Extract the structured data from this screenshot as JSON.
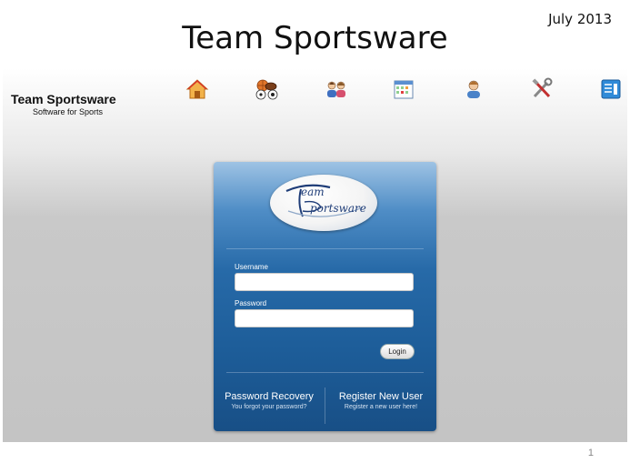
{
  "slide": {
    "title": "Team Sportsware",
    "date": "July 2013",
    "page_number": "1"
  },
  "app": {
    "brand_name": "Team Sportsware",
    "brand_tagline": "Software for Sports",
    "nav_icons": [
      "home-icon",
      "sports-balls-icon",
      "team-members-icon",
      "calendar-icon",
      "user-profile-icon",
      "tools-icon",
      "reports-icon"
    ]
  },
  "login": {
    "logo_line1": "eam",
    "logo_line2": "portsware",
    "username_label": "Username",
    "username_value": "",
    "password_label": "Password",
    "password_value": "",
    "login_button": "Login",
    "recovery_title": "Password Recovery",
    "recovery_sub": "You forgot your password?",
    "register_title": "Register New User",
    "register_sub": "Register a new user here!"
  }
}
